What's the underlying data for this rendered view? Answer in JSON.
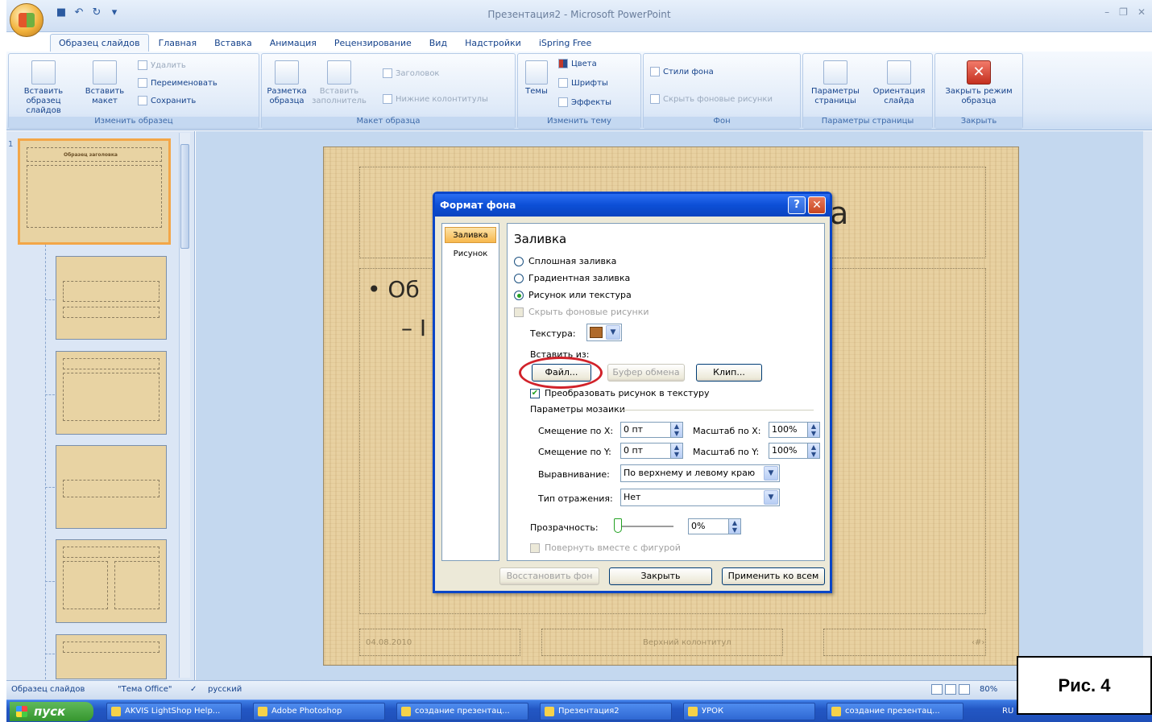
{
  "window": {
    "title": "Презентация2 - Microsoft PowerPoint"
  },
  "tabs": [
    "Образец слайдов",
    "Главная",
    "Вставка",
    "Анимация",
    "Рецензирование",
    "Вид",
    "Надстройки",
    "iSpring Free"
  ],
  "ribbon": {
    "group1": {
      "label": "Изменить образец",
      "insert_master": "Вставить образец слайдов",
      "insert_layout": "Вставить макет",
      "delete": "Удалить",
      "rename": "Переименовать",
      "save": "Сохранить"
    },
    "group2": {
      "label": "Макет образца",
      "master_layout": "Разметка образца",
      "insert_placeholder": "Вставить заполнитель",
      "title_cb": "Заголовок",
      "footers_cb": "Нижние колонтитулы"
    },
    "group3": {
      "label": "Изменить тему",
      "themes": "Темы",
      "colors": "Цвета",
      "fonts": "Шрифты",
      "effects": "Эффекты"
    },
    "group4": {
      "label": "Фон",
      "bg_styles": "Стили фона",
      "hide_bg": "Скрыть фоновые рисунки"
    },
    "group5": {
      "label": "Параметры страницы",
      "page_setup": "Параметры страницы",
      "orientation": "Ориентация слайда"
    },
    "group6": {
      "label": "Закрыть",
      "close_master": "Закрыть режим образца"
    }
  },
  "slide": {
    "bullet1": "• Об",
    "bullet2": "– I",
    "title_tail": "а",
    "date": "04.08.2010",
    "footer": "Верхний колонтитул",
    "num": "‹#›"
  },
  "thumbs": {
    "master_title": "Образец заголовка",
    "num": "1"
  },
  "dialog": {
    "title": "Формат фона",
    "nav": [
      "Заливка",
      "Рисунок"
    ],
    "heading": "Заливка",
    "options": [
      "Сплошная заливка",
      "Градиентная заливка",
      "Рисунок или текстура"
    ],
    "selected_option": "Рисунок или текстура",
    "hide_bg": "Скрыть фоновые рисунки",
    "texture_label": "Текстура:",
    "insert_from": "Вставить из:",
    "btn_file": "Файл...",
    "btn_clipboard": "Буфер обмена",
    "btn_clip": "Клип...",
    "tile_cb": "Преобразовать рисунок в текстуру",
    "tiling_section": "Параметры мозаики",
    "offset_x_label": "Смещение по X:",
    "offset_x": "0 пт",
    "scale_x_label": "Масштаб по X:",
    "scale_x": "100%",
    "offset_y_label": "Смещение по Y:",
    "offset_y": "0 пт",
    "scale_y_label": "Масштаб по Y:",
    "scale_y": "100%",
    "align_label": "Выравнивание:",
    "align_value": "По верхнему и левому краю",
    "mirror_label": "Тип отражения:",
    "mirror_value": "Нет",
    "transparency_label": "Прозрачность:",
    "transparency_value": "0%",
    "rotate_cb": "Повернуть вместе с фигурой",
    "btn_reset": "Восстановить фон",
    "btn_close": "Закрыть",
    "btn_apply_all": "Применить ко всем"
  },
  "status": {
    "view": "Образец слайдов",
    "theme": "\"Тема Office\"",
    "lang": "русский",
    "zoom": "80%"
  },
  "taskbar": {
    "start": "пуск",
    "tasks": [
      "AKVIS LightShop Help...",
      "Adobe Photoshop",
      "создание презентац...",
      "Презентация2",
      "УРОК",
      "создание презентац..."
    ],
    "lang": "RU"
  },
  "caption": "Рис. 4"
}
